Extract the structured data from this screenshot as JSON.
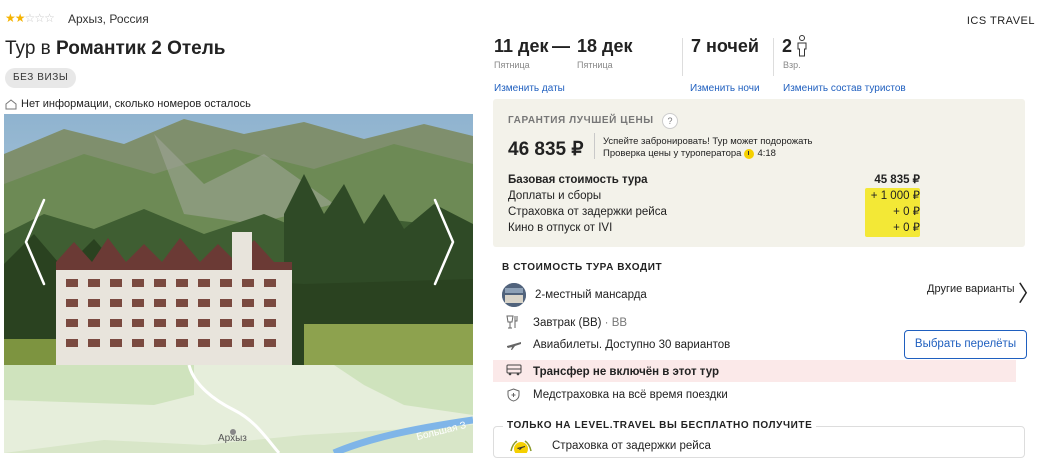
{
  "hotel": {
    "stars_filled": 2,
    "stars_total": 5,
    "location": "Архыз, Россия",
    "operator": "ICS TRAVEL",
    "title_prefix": "Тур в",
    "name": "Романтик 2 Отель",
    "visa_badge": "БЕЗ ВИЗЫ",
    "rooms_info": "Нет информации, сколько номеров осталось"
  },
  "map": {
    "town_label": "Архыз",
    "river_label": "Большая З"
  },
  "dates": {
    "from_date": "11 дек",
    "from_day": "Пятница",
    "separator": "—",
    "to_date": "18 дек",
    "to_day": "Пятница",
    "nights": "7 ночей",
    "tourists_count": "2",
    "tourists_label": "Взр.",
    "change_dates": "Изменить даты",
    "change_nights": "Изменить ночи",
    "change_tourists": "Изменить состав туристов"
  },
  "price": {
    "guarantee": "ГАРАНТИЯ ЛУЧШЕЙ ЦЕНЫ",
    "help": "?",
    "total": "46 835 ₽",
    "hurry_line1": "Успейте забронировать! Тур может подорожать",
    "hurry_line2": "Проверка цены у туроператора",
    "timer": "4:18",
    "rows": [
      {
        "label": "Базовая стоимость тура",
        "value": "45 835 ₽"
      },
      {
        "label": "Доплаты и сборы",
        "value": "+ 1 000 ₽"
      },
      {
        "label": "Страховка от задержки рейса",
        "value": "+ 0 ₽"
      },
      {
        "label": "Кино в отпуск от IVI",
        "value": "+ 0 ₽"
      }
    ]
  },
  "included": {
    "title": "В СТОИМОСТЬ ТУРА ВХОДИТ",
    "room": "2-местный мансарда",
    "other_options": "Другие варианты",
    "meal": "Завтрак (BB)",
    "meal_code": " · BB",
    "flights": "Авиабилеты. Доступно 30 вариантов",
    "choose_flights": "Выбрать перелёты",
    "transfer": "Трансфер не включён в этот тур",
    "insurance": "Медстраховка на всё время поездки"
  },
  "free": {
    "title": "ТОЛЬКО НА LEVEL.TRAVEL ВЫ БЕСПЛАТНО ПОЛУЧИТЕ",
    "item1": "Страховка от задержки рейса"
  }
}
